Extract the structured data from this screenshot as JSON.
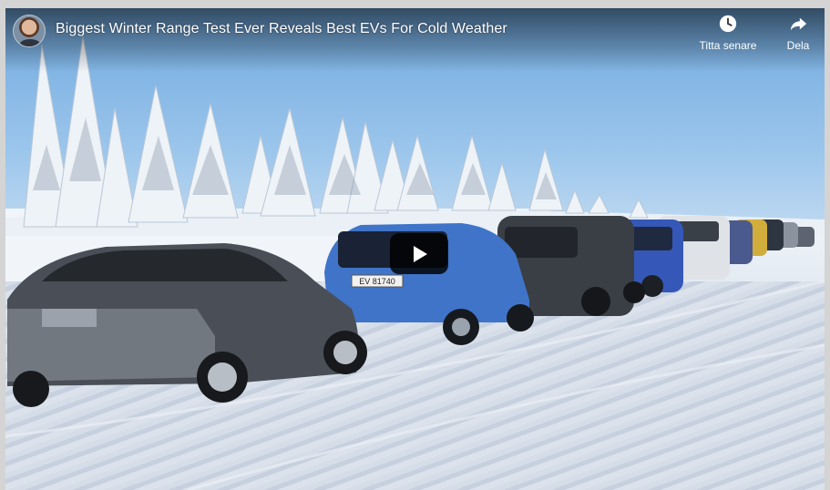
{
  "video": {
    "title": "Biggest Winter Range Test Ever Reveals Best EVs For Cold Weather",
    "channel_avatar": "avatar",
    "plate_text": "EV 81740"
  },
  "actions": {
    "watch_later": {
      "label": "Titta senare",
      "icon": "clock-icon"
    },
    "share": {
      "label": "Dela",
      "icon": "share-arrow-icon"
    }
  },
  "play_button": {
    "icon": "play-icon"
  }
}
